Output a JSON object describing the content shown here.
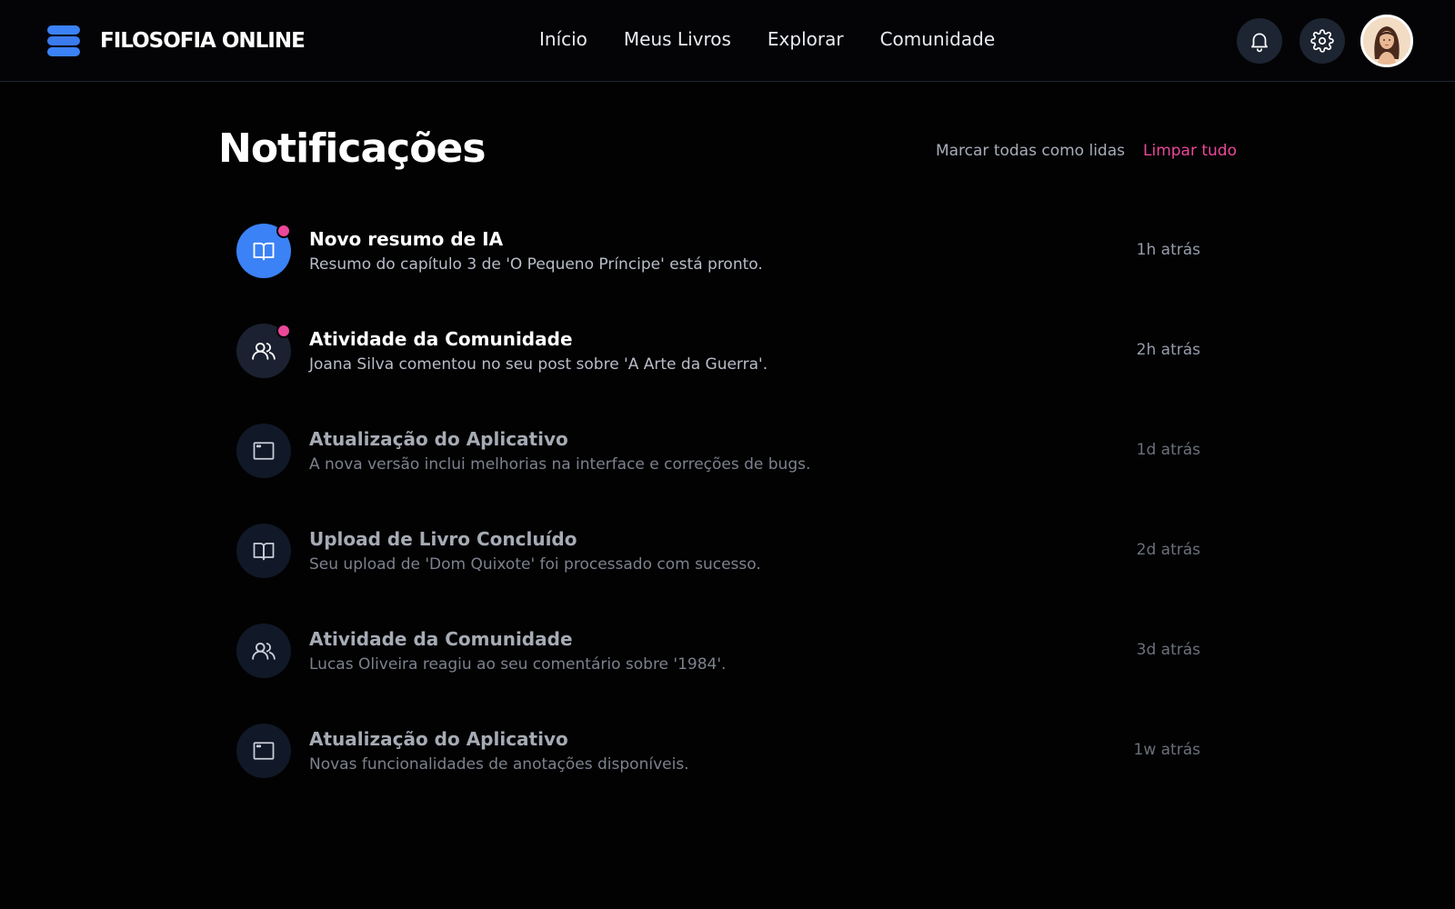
{
  "app": {
    "brand": "FILOSOFIA ONLINE",
    "colors": {
      "accent": "#3b82f6",
      "highlight": "#ec4899",
      "background": "#020203"
    }
  },
  "nav": {
    "items": [
      {
        "label": "Início"
      },
      {
        "label": "Meus Livros"
      },
      {
        "label": "Explorar"
      },
      {
        "label": "Comunidade"
      }
    ]
  },
  "header_actions": {
    "icons": [
      "bell-icon",
      "gear-icon",
      "avatar"
    ]
  },
  "page": {
    "title": "Notificações",
    "mark_all_read": "Marcar todas como lidas",
    "clear_all": "Limpar tudo"
  },
  "notifications": [
    {
      "icon": "book-icon",
      "title": "Novo resumo de IA",
      "desc": "Resumo do capítulo 3 de 'O Pequeno Príncipe' está pronto.",
      "time": "1h atrás",
      "unread": true
    },
    {
      "icon": "users-icon",
      "title": "Atividade da Comunidade",
      "desc": "Joana Silva comentou no seu post sobre 'A Arte da Guerra'.",
      "time": "2h atrás",
      "unread": true
    },
    {
      "icon": "app-window-icon",
      "title": "Atualização do Aplicativo",
      "desc": "A nova versão inclui melhorias na interface e correções de bugs.",
      "time": "1d atrás",
      "unread": false
    },
    {
      "icon": "book-icon",
      "title": "Upload de Livro Concluído",
      "desc": "Seu upload de 'Dom Quixote' foi processado com sucesso.",
      "time": "2d atrás",
      "unread": false
    },
    {
      "icon": "users-icon",
      "title": "Atividade da Comunidade",
      "desc": "Lucas Oliveira reagiu ao seu comentário sobre '1984'.",
      "time": "3d atrás",
      "unread": false
    },
    {
      "icon": "app-window-icon",
      "title": "Atualização do Aplicativo",
      "desc": "Novas funcionalidades de anotações disponíveis.",
      "time": "1w atrás",
      "unread": false
    }
  ]
}
